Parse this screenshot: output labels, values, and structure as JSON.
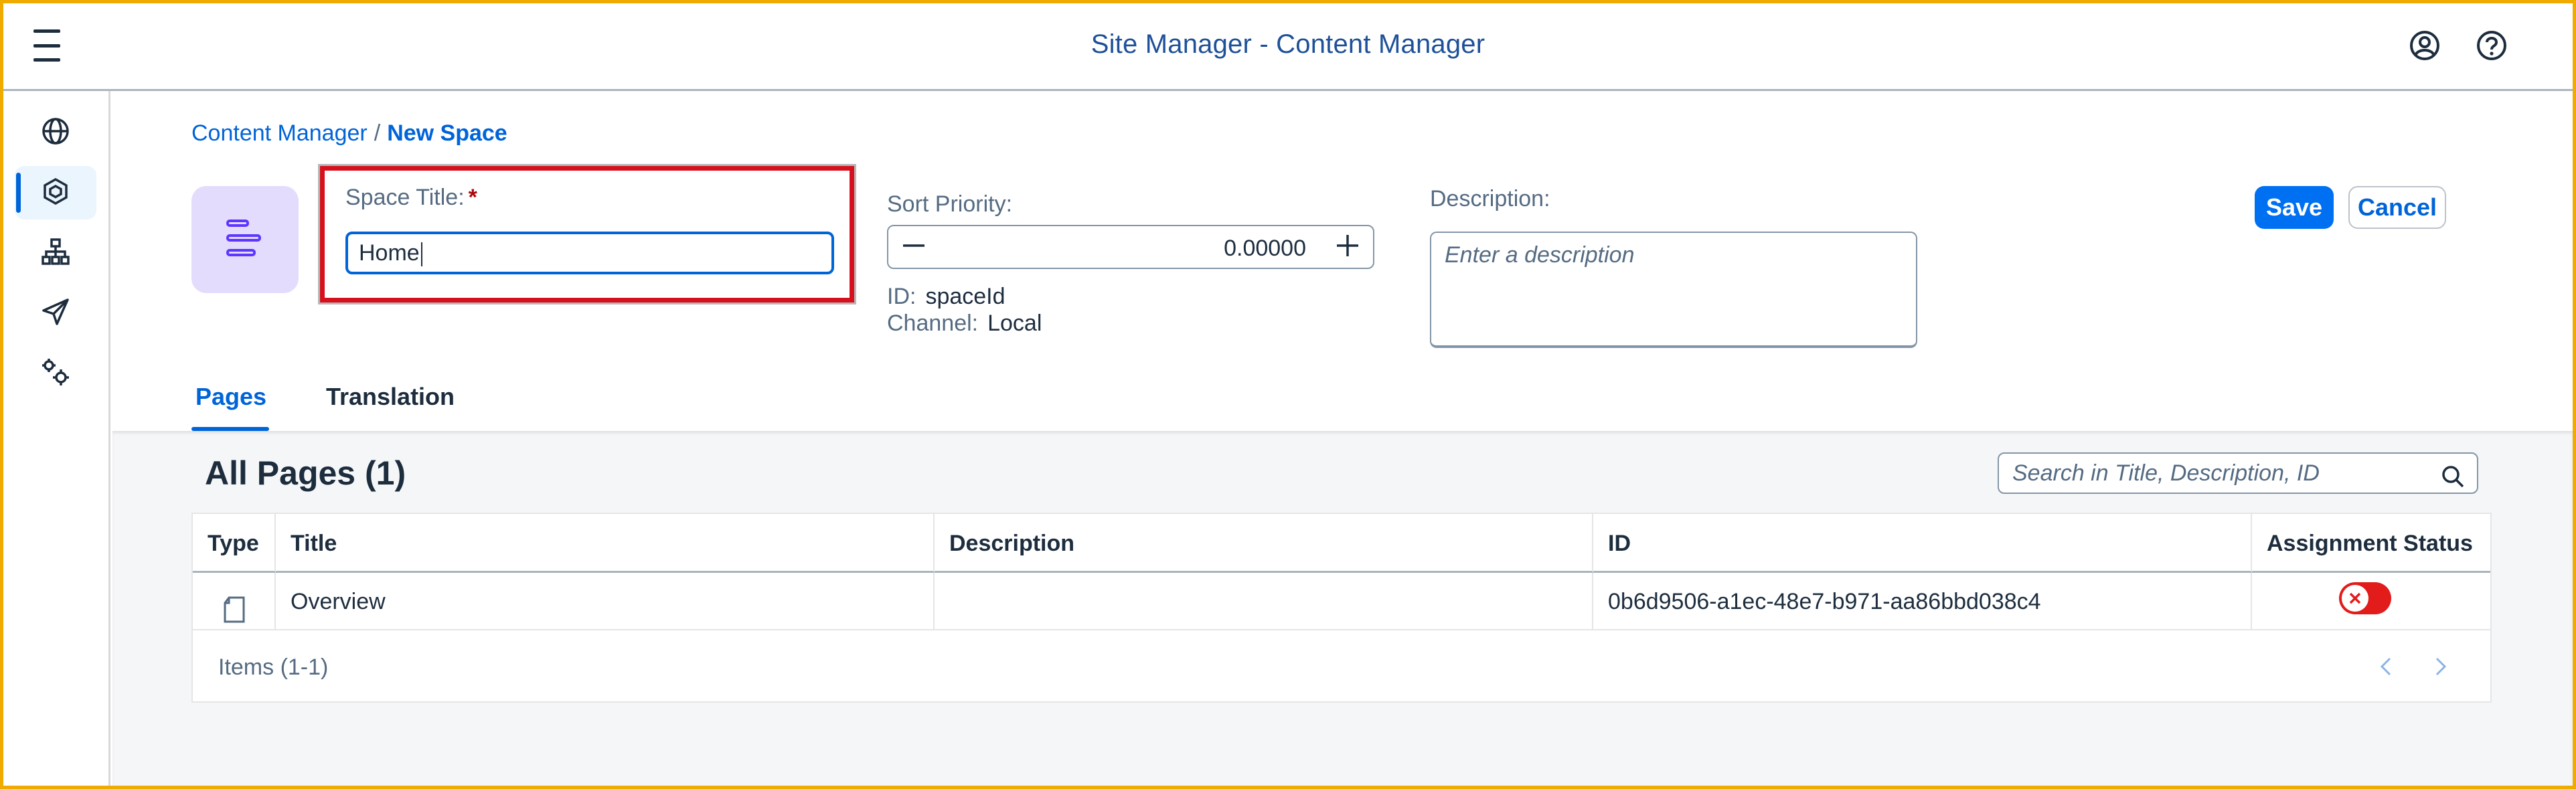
{
  "shell": {
    "title": "Site Manager - Content Manager"
  },
  "sidenav": {
    "items": [
      {
        "icon": "globe-icon"
      },
      {
        "icon": "content-cube-icon",
        "active": true
      },
      {
        "icon": "sitemap-icon"
      },
      {
        "icon": "paper-plane-icon"
      },
      {
        "icon": "settings-gears-icon"
      }
    ]
  },
  "breadcrumb": {
    "parent": "Content Manager",
    "separator": "/",
    "current": "New Space"
  },
  "form": {
    "space_title_label": "Space Title:",
    "required_mark": "*",
    "space_title_value": "Home",
    "sort_priority_label": "Sort Priority:",
    "sort_priority_value": "0.00000",
    "id_label": "ID:",
    "id_value": "spaceId",
    "channel_label": "Channel:",
    "channel_value": "Local",
    "description_label": "Description:",
    "description_placeholder": "Enter a description"
  },
  "actions": {
    "save": "Save",
    "cancel": "Cancel"
  },
  "tabs": [
    {
      "label": "Pages",
      "active": true
    },
    {
      "label": "Translation",
      "active": false
    }
  ],
  "pages": {
    "title": "All Pages (1)",
    "search_placeholder": "Search in Title, Description, ID",
    "columns": [
      "Type",
      "Title",
      "Description",
      "ID",
      "Assignment Status"
    ],
    "rows": [
      {
        "type_icon": "page-icon",
        "title": "Overview",
        "description": "",
        "id": "0b6d9506-a1ec-48e7-b971-aa86bbd038c4",
        "assigned": false
      }
    ],
    "items_count": "Items (1-1)"
  },
  "colors": {
    "accent": "#0064d9",
    "save_button": "#0070f2",
    "highlight_box": "#d6111d",
    "status_off": "#e21b1b",
    "avatar_bg": "#e4dcfd",
    "avatar_icon": "#5d36ff"
  }
}
